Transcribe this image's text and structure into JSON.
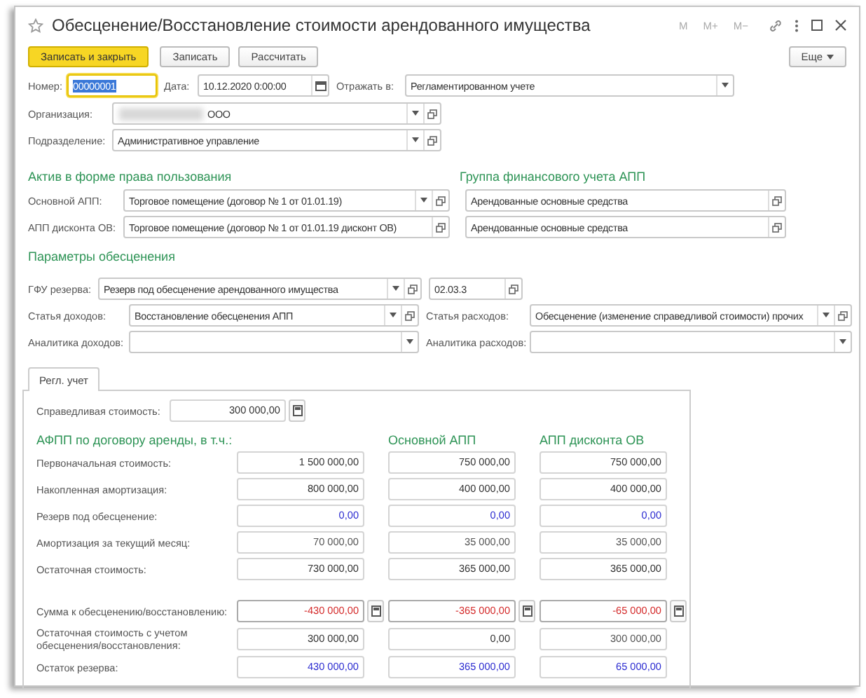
{
  "window": {
    "title": "Обесценение/Восстановление стоимости арендованного имущества",
    "title_buttons": [
      "M",
      "M+",
      "M−"
    ]
  },
  "toolbar": {
    "buttons": [
      {
        "label": "Записать и закрыть",
        "kind": "default"
      },
      {
        "label": "Записать",
        "kind": "normal"
      },
      {
        "label": "Рассчитать",
        "kind": "normal"
      }
    ],
    "more": "Еще"
  },
  "header": {
    "number": {
      "label": "Номер:",
      "value": "00000001",
      "focused": true
    },
    "date": {
      "label": "Дата:",
      "value": "10.12.2020  0:00:00"
    },
    "reflect": {
      "label": "Отражать в:",
      "value": "Регламентированном учете"
    },
    "organization": {
      "label": "Организация:",
      "value": "ООО"
    },
    "department": {
      "label": "Подразделение:",
      "value": "Административное управление"
    }
  },
  "asset": {
    "title": "Актив в форме права пользования",
    "main": {
      "label": "Основной АПП:",
      "value": "Торговое помещение (договор № 1 от 01.01.19)"
    },
    "discount": {
      "label": "АПП дисконта ОВ:",
      "value": "Торговое помещение (договор № 1 от 01.01.19 дисконт ОВ)"
    }
  },
  "finance_group": {
    "title": "Группа финансового учета АПП",
    "values": [
      "Арендованные основные средства",
      "Арендованные основные средства"
    ]
  },
  "impairment": {
    "title": "Параметры обесценения",
    "reserve": {
      "label": "ГФУ резерва:",
      "value": "Резерв под обесценение арендованного имущества",
      "code": "02.03.3"
    },
    "income_item": {
      "label": "Статья доходов:",
      "value": "Восстановление обесценения АПП"
    },
    "expense_item": {
      "label": "Статья расходов:",
      "value": "Обесценение (изменение справедливой стоимости) прочих"
    },
    "income_analytics": {
      "label": "Аналитика доходов:"
    },
    "expense_analytics": {
      "label": "Аналитика расходов:"
    }
  },
  "tabs": [
    {
      "label": "Регл. учет",
      "selected": true
    }
  ],
  "fair_value": {
    "label": "Справедливая стоимость:",
    "value": "300 000,00"
  },
  "columns": [
    "АФПП по договору аренды, в т.ч.:",
    "Основной АПП",
    "АПП дисконта ОВ"
  ],
  "rows": [
    {
      "label": "Первоначальная стоимость:",
      "values": [
        {
          "text": "1 500 000,00",
          "color": "#333333"
        },
        {
          "text": "750 000,00",
          "color": "#333333"
        },
        {
          "text": "750 000,00",
          "color": "#333333"
        }
      ]
    },
    {
      "label": "Накопленная амортизация:",
      "values": [
        {
          "text": "800 000,00",
          "color": "#333333"
        },
        {
          "text": "400 000,00",
          "color": "#333333"
        },
        {
          "text": "400 000,00",
          "color": "#333333"
        }
      ]
    },
    {
      "label": "Резерв под обесценение:",
      "values": [
        {
          "text": "0,00",
          "color": "#2b2bd0"
        },
        {
          "text": "0,00",
          "color": "#2b2bd0"
        },
        {
          "text": "0,00",
          "color": "#2b2bd0"
        }
      ]
    },
    {
      "label": "Амортизация за текущий месяц:",
      "values": [
        {
          "text": "70 000,00",
          "color": "#555555"
        },
        {
          "text": "35 000,00",
          "color": "#555555"
        },
        {
          "text": "35 000,00",
          "color": "#555555"
        }
      ]
    },
    {
      "label": "Остаточная стоимость:",
      "values": [
        {
          "text": "730 000,00",
          "color": "#333333"
        },
        {
          "text": "365 000,00",
          "color": "#333333"
        },
        {
          "text": "365 000,00",
          "color": "#333333"
        }
      ]
    }
  ],
  "result_rows": [
    {
      "label": "Сумма к обесценению/восстановлению:",
      "kind": "calc",
      "values": [
        {
          "text": "-430 000,00",
          "color": "#d42a2a"
        },
        {
          "text": "-365 000,00",
          "color": "#d42a2a"
        },
        {
          "text": "-65 000,00",
          "color": "#d42a2a"
        }
      ]
    },
    {
      "label": "Остаточная стоимость с учетом обесценения/восстановления:",
      "kind": "plain",
      "values": [
        {
          "text": "300 000,00",
          "color": "#333333"
        },
        {
          "text": "0,00",
          "color": "#333333"
        },
        {
          "text": "300 000,00",
          "color": "#555555"
        }
      ]
    },
    {
      "label": "Остаток резерва:",
      "kind": "plain",
      "values": [
        {
          "text": "430 000,00",
          "color": "#2b2bd0"
        },
        {
          "text": "365 000,00",
          "color": "#2b2bd0"
        },
        {
          "text": "65 000,00",
          "color": "#2b2bd0"
        }
      ]
    }
  ]
}
